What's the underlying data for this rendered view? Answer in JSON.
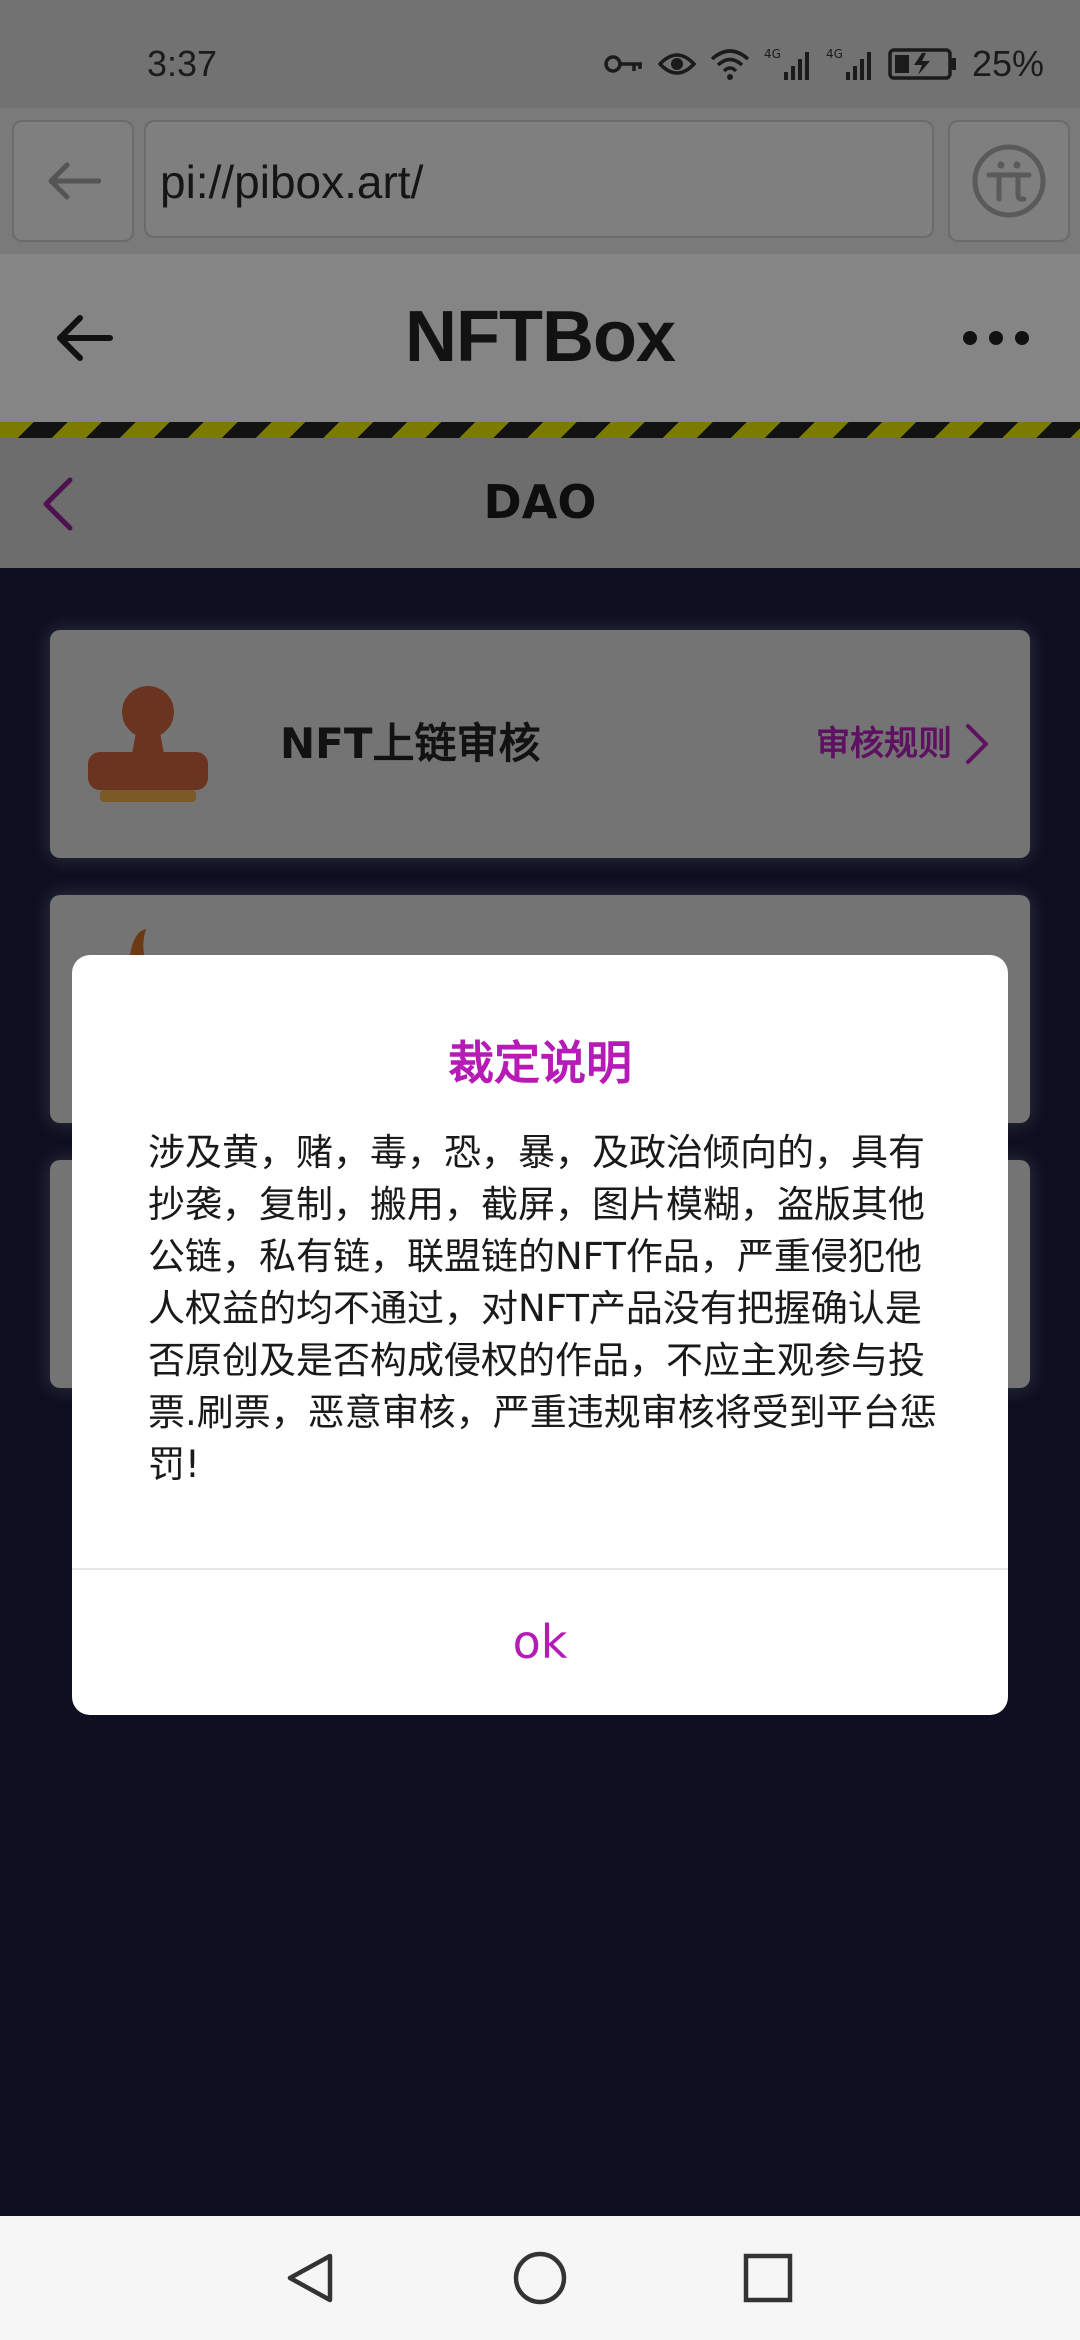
{
  "status_bar": {
    "time": "3:37",
    "battery": "25%",
    "icons": [
      "key-icon",
      "eye-icon",
      "wifi-icon",
      "signal-4g-icon",
      "signal-4g-icon",
      "battery-charging-icon"
    ],
    "network_label": "4G"
  },
  "browser": {
    "url": "pi://pibox.art/",
    "back_icon": "arrow-left-icon",
    "pi_icon": "pi-logo-icon"
  },
  "app_header": {
    "title": "NFTBox",
    "back_icon": "arrow-left-icon",
    "more_icon": "more-horizontal-icon"
  },
  "sub_header": {
    "title": "DAO",
    "back_icon": "chevron-left-icon"
  },
  "cards": [
    {
      "title": "NFT上链审核",
      "link": "审核规则",
      "icon": "stamp-icon"
    }
  ],
  "modal": {
    "title": "裁定说明",
    "body": "涉及黄，赌，毒，恐，暴，及政治倾向的，具有抄袭，复制，搬用，截屏，图片模糊，盗版其他公链，私有链，联盟链的NFT作品，严重侵犯他人权益的均不通过，对NFT产品没有把握确认是否原创及是否构成侵权的作品，不应主观参与投票.刷票，恶意审核，严重违规审核将受到平台惩罚!",
    "ok_label": "ok"
  },
  "nav_bar": {
    "icons": [
      "nav-back-icon",
      "nav-home-icon",
      "nav-recents-icon"
    ]
  },
  "colors": {
    "accent": "#b61bb6",
    "link": "#5e1160",
    "page_bg": "#0e1022"
  }
}
